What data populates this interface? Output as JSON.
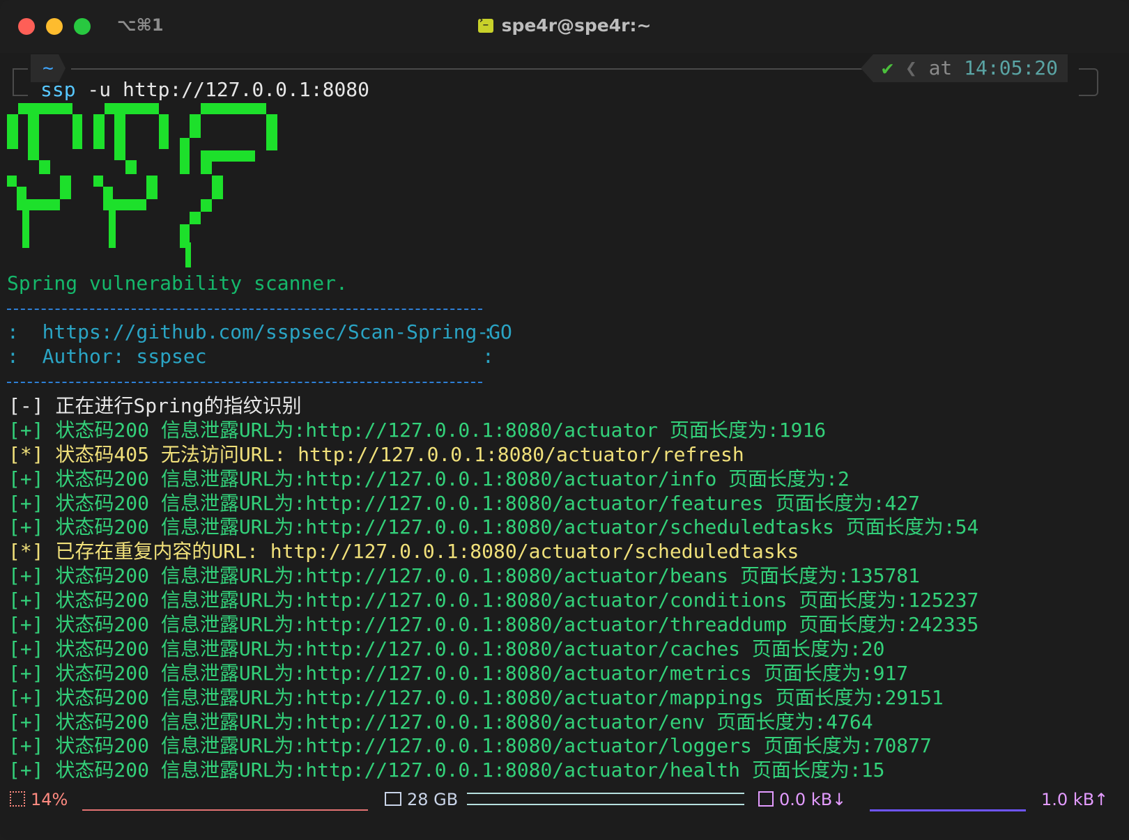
{
  "window": {
    "shortcut": "⌥⌘1",
    "title": "spe4r@spe4r:~"
  },
  "prompt": {
    "cwd": "~",
    "status_check": "✔",
    "at_label": "at",
    "time": "14:05:20"
  },
  "command": {
    "name": "ssp",
    "args": " -u http://127.0.0.1:8080"
  },
  "banner": {
    "tagline": "Spring vulnerability scanner.",
    "colon": ":",
    "repo": "  https://github.com/sspsec/Scan-Spring-GO",
    "author": "  Author: sspsec"
  },
  "log": [
    {
      "cls": "w",
      "text": "[-] 正在进行Spring的指纹识别"
    },
    {
      "cls": "g",
      "text": "[+] 状态码200 信息泄露URL为:http://127.0.0.1:8080/actuator 页面长度为:1916"
    },
    {
      "cls": "y",
      "text": "[*] 状态码405 无法访问URL: http://127.0.0.1:8080/actuator/refresh"
    },
    {
      "cls": "g",
      "text": "[+] 状态码200 信息泄露URL为:http://127.0.0.1:8080/actuator/info 页面长度为:2"
    },
    {
      "cls": "g",
      "text": "[+] 状态码200 信息泄露URL为:http://127.0.0.1:8080/actuator/features 页面长度为:427"
    },
    {
      "cls": "g",
      "text": "[+] 状态码200 信息泄露URL为:http://127.0.0.1:8080/actuator/scheduledtasks 页面长度为:54"
    },
    {
      "cls": "y",
      "text": "[*] 已存在重复内容的URL: http://127.0.0.1:8080/actuator/scheduledtasks"
    },
    {
      "cls": "g",
      "text": "[+] 状态码200 信息泄露URL为:http://127.0.0.1:8080/actuator/beans 页面长度为:135781"
    },
    {
      "cls": "g",
      "text": "[+] 状态码200 信息泄露URL为:http://127.0.0.1:8080/actuator/conditions 页面长度为:125237"
    },
    {
      "cls": "g",
      "text": "[+] 状态码200 信息泄露URL为:http://127.0.0.1:8080/actuator/threaddump 页面长度为:242335"
    },
    {
      "cls": "g",
      "text": "[+] 状态码200 信息泄露URL为:http://127.0.0.1:8080/actuator/caches 页面长度为:20"
    },
    {
      "cls": "g",
      "text": "[+] 状态码200 信息泄露URL为:http://127.0.0.1:8080/actuator/metrics 页面长度为:917"
    },
    {
      "cls": "g",
      "text": "[+] 状态码200 信息泄露URL为:http://127.0.0.1:8080/actuator/mappings 页面长度为:29151"
    },
    {
      "cls": "g",
      "text": "[+] 状态码200 信息泄露URL为:http://127.0.0.1:8080/actuator/env 页面长度为:4764"
    },
    {
      "cls": "g",
      "text": "[+] 状态码200 信息泄露URL为:http://127.0.0.1:8080/actuator/loggers 页面长度为:70877"
    },
    {
      "cls": "g",
      "text": "[+] 状态码200 信息泄露URL为:http://127.0.0.1:8080/actuator/health 页面长度为:15"
    }
  ],
  "statusbar": {
    "cpu": "14%",
    "memory": "28 GB",
    "net_down": "0.0 kB↓",
    "net_up": "1.0 kB↑"
  },
  "colors": {
    "logo": "#1de02b",
    "ok_line": "#33d17a",
    "warn_line": "#f0e07a"
  }
}
